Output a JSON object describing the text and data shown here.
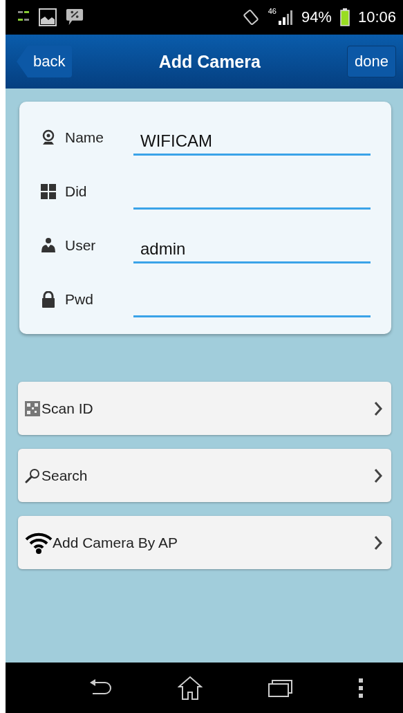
{
  "status_bar": {
    "network": "46",
    "battery": "94%",
    "time": "10:06"
  },
  "header": {
    "back": "back",
    "title": "Add Camera",
    "done": "done"
  },
  "fields": [
    {
      "kind": "camera",
      "label": "Name",
      "value": "WIFICAM"
    },
    {
      "kind": "grid",
      "label": "Did"
    },
    {
      "kind": "user",
      "label": "User",
      "value": "admin"
    },
    {
      "kind": "lock",
      "label": "Pwd"
    }
  ],
  "actions": [
    {
      "kind": "qr",
      "label": "Scan ID"
    },
    {
      "kind": "search",
      "label": "Search"
    },
    {
      "kind": "wifi",
      "label": "Add Camera By AP"
    }
  ]
}
